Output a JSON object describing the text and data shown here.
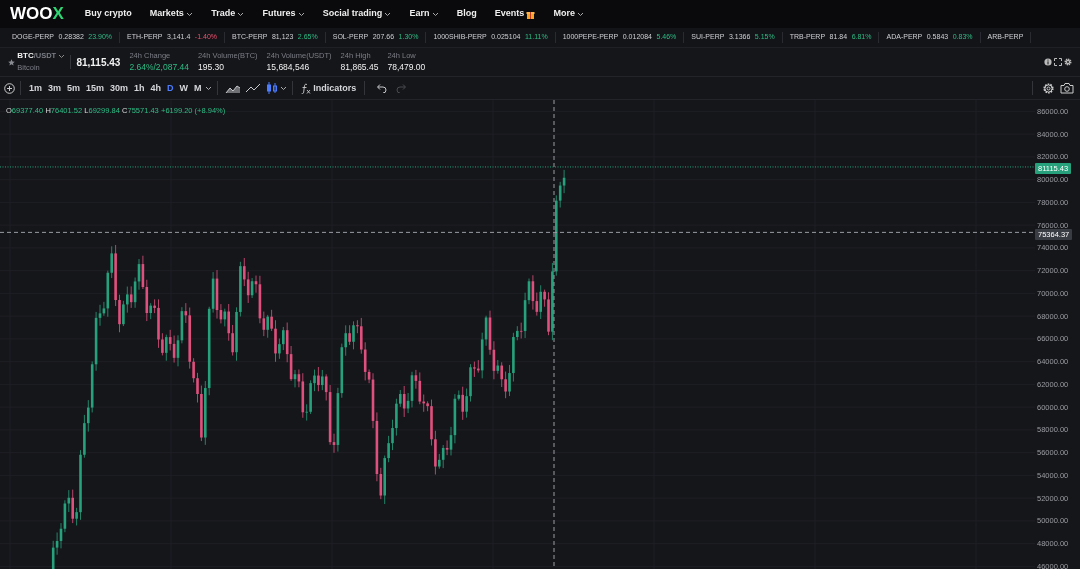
{
  "nav": {
    "logo": "WOOX",
    "items": [
      {
        "label": "Buy crypto",
        "dropdown": false,
        "gift": false
      },
      {
        "label": "Markets",
        "dropdown": true,
        "gift": false
      },
      {
        "label": "Trade",
        "dropdown": true,
        "gift": false
      },
      {
        "label": "Futures",
        "dropdown": true,
        "gift": false
      },
      {
        "label": "Social trading",
        "dropdown": true,
        "gift": false
      },
      {
        "label": "Earn",
        "dropdown": true,
        "gift": false
      },
      {
        "label": "Blog",
        "dropdown": false,
        "gift": false
      },
      {
        "label": "Events",
        "dropdown": false,
        "gift": true
      },
      {
        "label": "More",
        "dropdown": true,
        "gift": false
      }
    ]
  },
  "ticker": [
    {
      "symbol": "DOGE-PERP",
      "price": "0.28382",
      "change": "23.90%",
      "negative": false
    },
    {
      "symbol": "ETH-PERP",
      "price": "3,141.4",
      "change": "-1.40%",
      "negative": true
    },
    {
      "symbol": "BTC-PERP",
      "price": "81,123",
      "change": "2.65%",
      "negative": false
    },
    {
      "symbol": "SOL-PERP",
      "price": "207.66",
      "change": "1.30%",
      "negative": false
    },
    {
      "symbol": "1000SHIB-PERP",
      "price": "0.025104",
      "change": "11.11%",
      "negative": false
    },
    {
      "symbol": "1000PEPE-PERP",
      "price": "0.012084",
      "change": "5.46%",
      "negative": false
    },
    {
      "symbol": "SUI-PERP",
      "price": "3.1366",
      "change": "5.15%",
      "negative": false
    },
    {
      "symbol": "TRB-PERP",
      "price": "81.84",
      "change": "6.81%",
      "negative": false
    },
    {
      "symbol": "ADA-PERP",
      "price": "0.5843",
      "change": "0.83%",
      "negative": false
    },
    {
      "symbol": "ARB-PERP"
    }
  ],
  "pair": {
    "base": "BTC",
    "quote": "/USDT",
    "name": "Bitcoin",
    "price": "81,115.43"
  },
  "stats": [
    {
      "label": "24h Change",
      "value": "2.64%/2,087.44",
      "positive": true
    },
    {
      "label": "24h Volume(BTC)",
      "value": "195.30",
      "positive": false
    },
    {
      "label": "24h Volume(USDT)",
      "value": "15,684,546",
      "positive": false
    },
    {
      "label": "24h High",
      "value": "81,865.45",
      "positive": false
    },
    {
      "label": "24h Low",
      "value": "78,479.00",
      "positive": false
    }
  ],
  "toolbar": {
    "intervals": [
      {
        "label": "1m",
        "selected": false
      },
      {
        "label": "3m",
        "selected": false
      },
      {
        "label": "5m",
        "selected": false
      },
      {
        "label": "15m",
        "selected": false
      },
      {
        "label": "30m",
        "selected": false
      },
      {
        "label": "1h",
        "selected": false
      },
      {
        "label": "4h",
        "selected": false
      },
      {
        "label": "D",
        "selected": true
      },
      {
        "label": "W",
        "selected": false
      },
      {
        "label": "M",
        "selected": false
      }
    ],
    "chart_types": [
      {
        "kind": "area",
        "selected": false
      },
      {
        "kind": "line",
        "selected": false
      },
      {
        "kind": "candles",
        "selected": true
      }
    ],
    "indicators": "Indicators",
    "undo_disabled": false,
    "redo_disabled": true
  },
  "ohlc": {
    "fields": [
      {
        "letter": "O",
        "value": "69377.40"
      },
      {
        "letter": "H",
        "value": "76401.52"
      },
      {
        "letter": "L",
        "value": "69299.84"
      },
      {
        "letter": "C",
        "value": "75571.43"
      }
    ],
    "change": "+6199.20 (+8.94%)"
  },
  "price_axis": [
    "86000.00",
    "84000.00",
    "82000.00",
    "80000.00",
    "78000.00",
    "76000.00",
    "74000.00",
    "72000.00",
    "70000.00",
    "68000.00",
    "66000.00",
    "64000.00",
    "62000.00",
    "60000.00",
    "58000.00",
    "56000.00",
    "54000.00",
    "52000.00",
    "50000.00",
    "48000.00",
    "46000.00"
  ],
  "last_price_tag": "81115.43",
  "crosshair_tag": "75364.37"
}
